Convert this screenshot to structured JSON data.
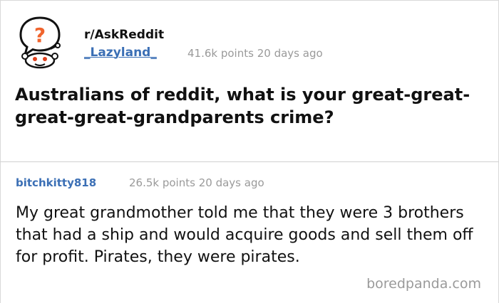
{
  "post": {
    "subreddit": "r/AskReddit",
    "author": "_Lazyland_",
    "points": "41.6k points",
    "age": "20 days ago",
    "title": "Australians of reddit, what is your great-great-great-great-grandparents crime?",
    "avatar_icon": "askreddit-snoo-question-icon"
  },
  "comment": {
    "author": "bitchkitty818",
    "points": "26.5k points",
    "age": "20 days ago",
    "body": "My great grandmother told me that they were 3 brothers that had a ship and would acquire goods and sell them off for profit. Pirates, they were pirates."
  },
  "watermark": "boredpanda.com",
  "colors": {
    "link_blue": "#3b6fb5",
    "meta_gray": "#9a9a9a",
    "question_orange": "#f0642d"
  }
}
